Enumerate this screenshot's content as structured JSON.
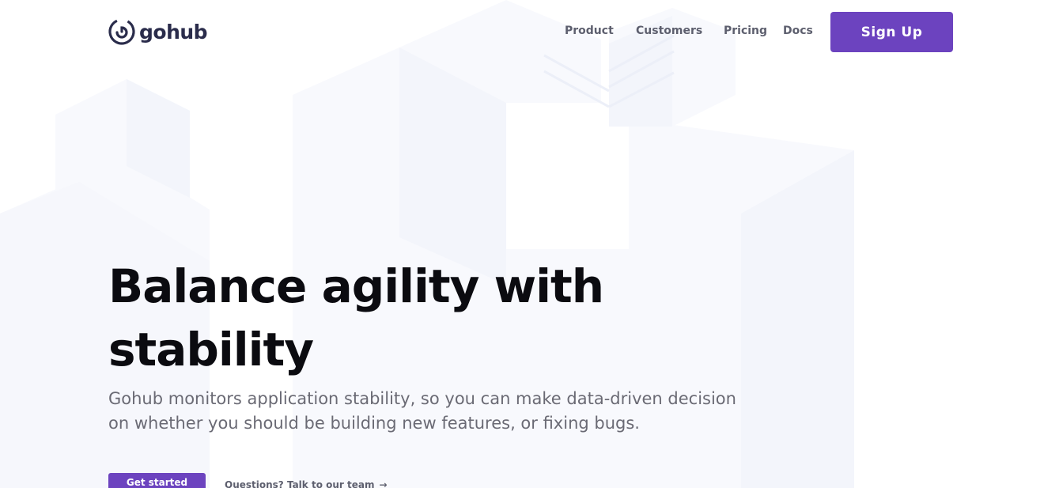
{
  "brand": {
    "name": "gohub",
    "accent_color": "#6c43bf",
    "logo_icon": "gohub-spiral-logo-icon"
  },
  "nav": {
    "items": [
      {
        "label": "Product"
      },
      {
        "label": "Customers"
      },
      {
        "label": "Pricing"
      },
      {
        "label": "Docs"
      }
    ],
    "signup_label": "Sign Up"
  },
  "hero": {
    "title": "Balance agility with stability",
    "subtitle": "Gohub monitors application stability, so you can make data-driven decision on whether you should be building new features, or fixing bugs.",
    "cta_label": "Get started",
    "secondary_link": "Questions? Talk to our team",
    "secondary_icon": "arrow-right-icon"
  }
}
